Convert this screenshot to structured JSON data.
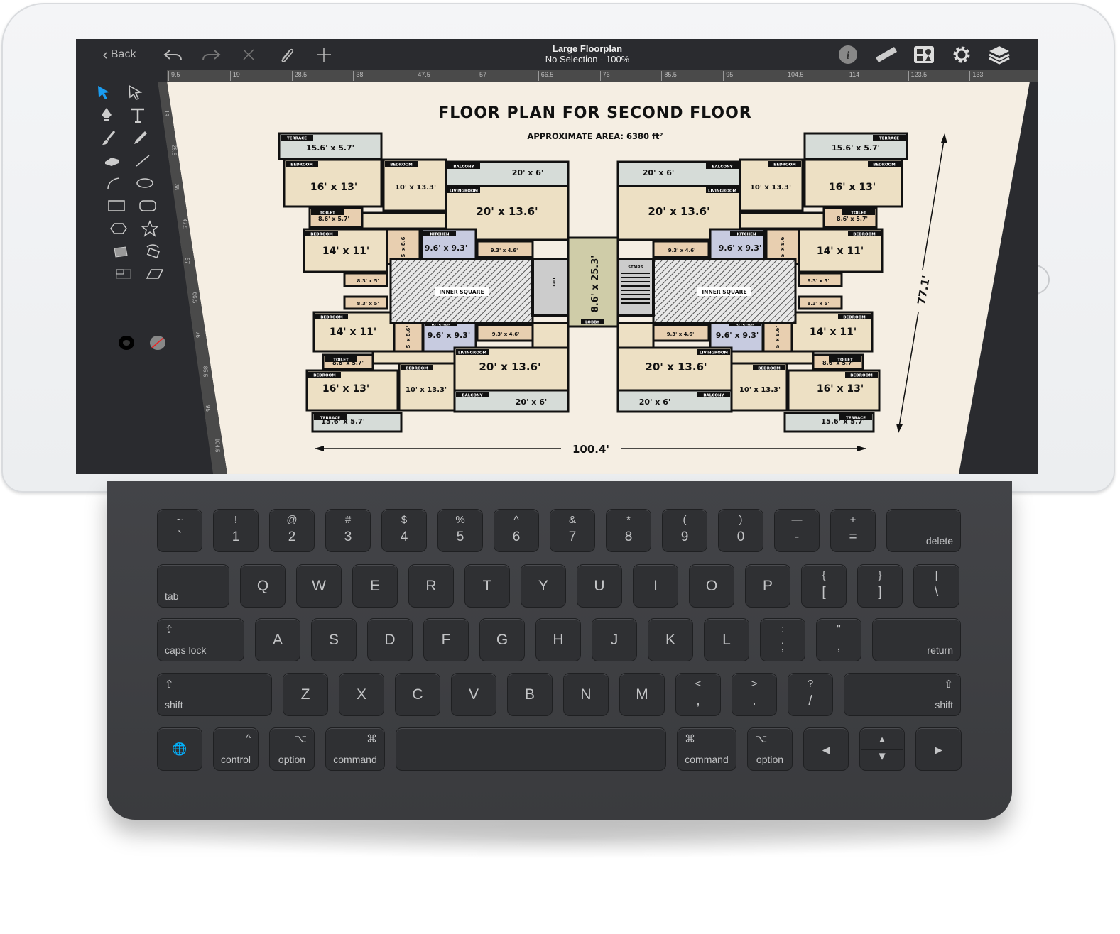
{
  "app": {
    "title": "Large Floorplan",
    "status": "No Selection - 100%",
    "back_label": "Back",
    "toolbar_left_icons": [
      "undo-icon",
      "redo-icon",
      "close-icon",
      "paperclip-icon",
      "plus-icon"
    ],
    "toolbar_right_icons": [
      "info-icon",
      "ruler-icon",
      "shapes-library-icon",
      "gear-icon",
      "layers-icon"
    ],
    "ruler_top": [
      "9.5",
      "19",
      "28.5",
      "38",
      "47.5",
      "57",
      "66.5",
      "76",
      "85.5",
      "95",
      "104.5",
      "114",
      "123.5",
      "133"
    ],
    "ruler_left": [
      "19",
      "28.5",
      "38",
      "47.5",
      "57",
      "66.5",
      "76",
      "85.5",
      "95",
      "104.5"
    ],
    "tools": [
      "select-arrow",
      "direct-select-arrow",
      "pen",
      "text",
      "brush",
      "pencil",
      "eraser",
      "line",
      "arc",
      "ellipse",
      "rectangle",
      "rounded-rectangle",
      "hexagon",
      "star",
      "image",
      "rotate",
      "crop",
      "skew",
      "stroke-color",
      "fill-color"
    ],
    "accent": "#1a9cf0"
  },
  "floorplan": {
    "title": "FLOOR PLAN FOR SECOND FLOOR",
    "subtitle": "APPROXIMATE AREA: 6380 ft²",
    "width_label": "100.4'",
    "height_label": "77.1'",
    "core_label": "8.6' x 25.3'",
    "inner_square": "INNER SQUARE",
    "stairs": "STAIRS",
    "lift": "LIFT",
    "rooms": {
      "terrace": "15.6' x 5.7'",
      "bedroom_large": "16' x 13'",
      "bedroom_small": "10' x 13.3'",
      "balcony": "20' x 6'",
      "living": "20' x 13.6'",
      "toilet_a": "8.6' x 5.7'",
      "bedroom_mid": "14' x 11'",
      "store": "5' x 8.6'",
      "kitchen": "9.6' x 9.3'",
      "utility": "9.3' x 4.6'",
      "toilet_b": "8.3' x 5'"
    },
    "tags": {
      "terrace": "TERRACE",
      "bedroom": "BEDROOM",
      "balcony": "BALCONY",
      "living": "LIVINGROOM",
      "toilet": "TOILET",
      "lobby": "LOBBY",
      "kitchen": "KITCHEN"
    }
  },
  "keyboard": {
    "rows": [
      [
        {
          "top": "~",
          "bot": "`"
        },
        {
          "top": "!",
          "bot": "1"
        },
        {
          "top": "@",
          "bot": "2"
        },
        {
          "top": "#",
          "bot": "3"
        },
        {
          "top": "$",
          "bot": "4"
        },
        {
          "top": "%",
          "bot": "5"
        },
        {
          "top": "^",
          "bot": "6"
        },
        {
          "top": "&",
          "bot": "7"
        },
        {
          "top": "*",
          "bot": "8"
        },
        {
          "top": "(",
          "bot": "9"
        },
        {
          "top": ")",
          "bot": "0"
        },
        {
          "top": "—",
          "bot": "-"
        },
        {
          "top": "+",
          "bot": "="
        },
        {
          "label": "delete"
        }
      ],
      [
        {
          "label": "tab"
        },
        {
          "main": "Q"
        },
        {
          "main": "W"
        },
        {
          "main": "E"
        },
        {
          "main": "R"
        },
        {
          "main": "T"
        },
        {
          "main": "Y"
        },
        {
          "main": "U"
        },
        {
          "main": "I"
        },
        {
          "main": "O"
        },
        {
          "main": "P"
        },
        {
          "top": "{",
          "bot": "["
        },
        {
          "top": "}",
          "bot": "]"
        },
        {
          "top": "|",
          "bot": "\\"
        }
      ],
      [
        {
          "label": "caps lock",
          "glyph": "⇪"
        },
        {
          "main": "A"
        },
        {
          "main": "S"
        },
        {
          "main": "D"
        },
        {
          "main": "F"
        },
        {
          "main": "G"
        },
        {
          "main": "H"
        },
        {
          "main": "J"
        },
        {
          "main": "K"
        },
        {
          "main": "L"
        },
        {
          "top": ":",
          "bot": ";"
        },
        {
          "top": "\"",
          "bot": ","
        },
        {
          "label": "return"
        }
      ],
      [
        {
          "label": "shift",
          "glyph": "⇧"
        },
        {
          "main": "Z"
        },
        {
          "main": "X"
        },
        {
          "main": "C"
        },
        {
          "main": "V"
        },
        {
          "main": "B"
        },
        {
          "main": "N"
        },
        {
          "main": "M"
        },
        {
          "top": "<",
          "bot": ","
        },
        {
          "top": ">",
          "bot": "."
        },
        {
          "top": "?",
          "bot": "/"
        },
        {
          "label": "shift",
          "glyph": "⇧"
        }
      ],
      [
        {
          "glyph": "🌐"
        },
        {
          "label": "control",
          "glyph": "^"
        },
        {
          "label": "option",
          "glyph": "⌥"
        },
        {
          "label": "command",
          "glyph": "⌘"
        },
        {
          "label": ""
        },
        {
          "label": "command",
          "glyph": "⌘"
        },
        {
          "label": "option",
          "glyph": "⌥"
        },
        {
          "main": "◂"
        },
        {
          "top": "▴",
          "bot": "▾"
        },
        {
          "main": "▸"
        }
      ]
    ]
  }
}
